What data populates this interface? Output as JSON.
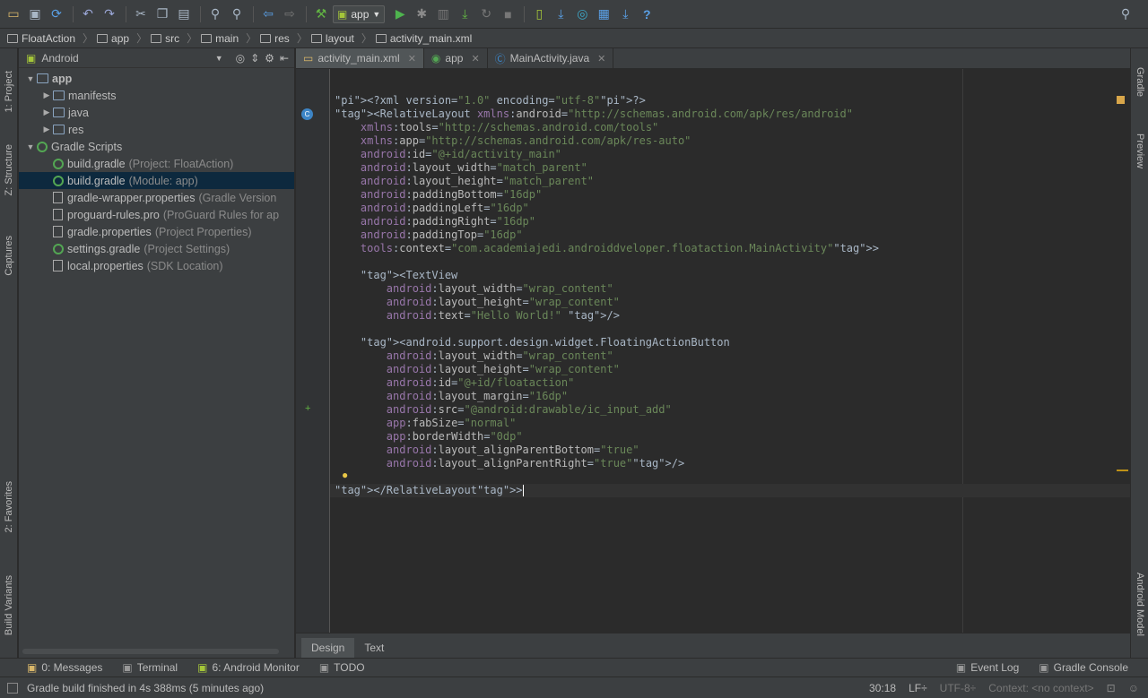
{
  "toolbar": {
    "run_config": "app",
    "help": "?"
  },
  "breadcrumb": [
    "FloatAction",
    "app",
    "src",
    "main",
    "res",
    "layout",
    "activity_main.xml"
  ],
  "left_tool_tabs": [
    "1: Project",
    "Z: Structure",
    "Captures",
    "2: Favorites",
    "Build Variants"
  ],
  "right_tool_tabs": [
    "Gradle",
    "Preview",
    "Android Model"
  ],
  "project": {
    "view": "Android",
    "tree": [
      {
        "label": "app",
        "note": "",
        "depth": 0,
        "icon": "module",
        "expanded": true
      },
      {
        "label": "manifests",
        "note": "",
        "depth": 1,
        "icon": "folder",
        "expanded": false
      },
      {
        "label": "java",
        "note": "",
        "depth": 1,
        "icon": "folder",
        "expanded": false
      },
      {
        "label": "res",
        "note": "",
        "depth": 1,
        "icon": "folder",
        "expanded": false
      },
      {
        "label": "Gradle Scripts",
        "note": "",
        "depth": 0,
        "icon": "gradle",
        "expanded": true
      },
      {
        "label": "build.gradle",
        "note": "(Project: FloatAction)",
        "depth": 1,
        "icon": "gradle"
      },
      {
        "label": "build.gradle",
        "note": "(Module: app)",
        "depth": 1,
        "icon": "gradle",
        "selected": true
      },
      {
        "label": "gradle-wrapper.properties",
        "note": "(Gradle Version",
        "depth": 1,
        "icon": "props"
      },
      {
        "label": "proguard-rules.pro",
        "note": "(ProGuard Rules for ap",
        "depth": 1,
        "icon": "file"
      },
      {
        "label": "gradle.properties",
        "note": "(Project Properties)",
        "depth": 1,
        "icon": "props"
      },
      {
        "label": "settings.gradle",
        "note": "(Project Settings)",
        "depth": 1,
        "icon": "gradle"
      },
      {
        "label": "local.properties",
        "note": "(SDK Location)",
        "depth": 1,
        "icon": "props"
      }
    ]
  },
  "editor_tabs": [
    {
      "label": "activity_main.xml",
      "active": true
    },
    {
      "label": "app",
      "active": false
    },
    {
      "label": "MainActivity.java",
      "active": false
    }
  ],
  "code_lines": [
    "<?xml version=\"1.0\" encoding=\"utf-8\"?>",
    "<RelativeLayout xmlns:android=\"http://schemas.android.com/apk/res/android\"",
    "    xmlns:tools=\"http://schemas.android.com/tools\"",
    "    xmlns:app=\"http://schemas.android.com/apk/res-auto\"",
    "    android:id=\"@+id/activity_main\"",
    "    android:layout_width=\"match_parent\"",
    "    android:layout_height=\"match_parent\"",
    "    android:paddingBottom=\"16dp\"",
    "    android:paddingLeft=\"16dp\"",
    "    android:paddingRight=\"16dp\"",
    "    android:paddingTop=\"16dp\"",
    "    tools:context=\"com.academiajedi.androiddveloper.floataction.MainActivity\">",
    "",
    "    <TextView",
    "        android:layout_width=\"wrap_content\"",
    "        android:layout_height=\"wrap_content\"",
    "        android:text=\"Hello World!\" />",
    "",
    "    <android.support.design.widget.FloatingActionButton",
    "        android:layout_width=\"wrap_content\"",
    "        android:layout_height=\"wrap_content\"",
    "        android:id=\"@+id/floataction\"",
    "        android:layout_margin=\"16dp\"",
    "        android:src=\"@android:drawable/ic_input_add\"",
    "        app:fabSize=\"normal\"",
    "        app:borderWidth=\"0dp\"",
    "        android:layout_alignParentBottom=\"true\"",
    "        android:layout_alignParentRight=\"true\"/>",
    "",
    "</RelativeLayout>"
  ],
  "view_tabs": [
    {
      "label": "Design",
      "active": true
    },
    {
      "label": "Text",
      "active": false
    }
  ],
  "tool_windows": [
    {
      "label": "0: Messages",
      "icon": "messages-icon"
    },
    {
      "label": "Terminal",
      "icon": "terminal-icon"
    },
    {
      "label": "6: Android Monitor",
      "icon": "android-icon"
    },
    {
      "label": "TODO",
      "icon": "todo-icon"
    }
  ],
  "tool_windows_right": [
    {
      "label": "Event Log",
      "icon": "event-log-icon"
    },
    {
      "label": "Gradle Console",
      "icon": "console-icon"
    }
  ],
  "status": {
    "message": "Gradle build finished in 4s 388ms (5 minutes ago)",
    "position": "30:18",
    "line_sep": "LF÷",
    "encoding": "UTF-8÷",
    "context": "Context: <no context>"
  },
  "colors": {
    "bg": "#2b2b2b",
    "panel": "#3c3f41",
    "selection": "#0d293e",
    "tag": "#e8bf6a",
    "value": "#6a8759",
    "namespace": "#9876aa"
  }
}
